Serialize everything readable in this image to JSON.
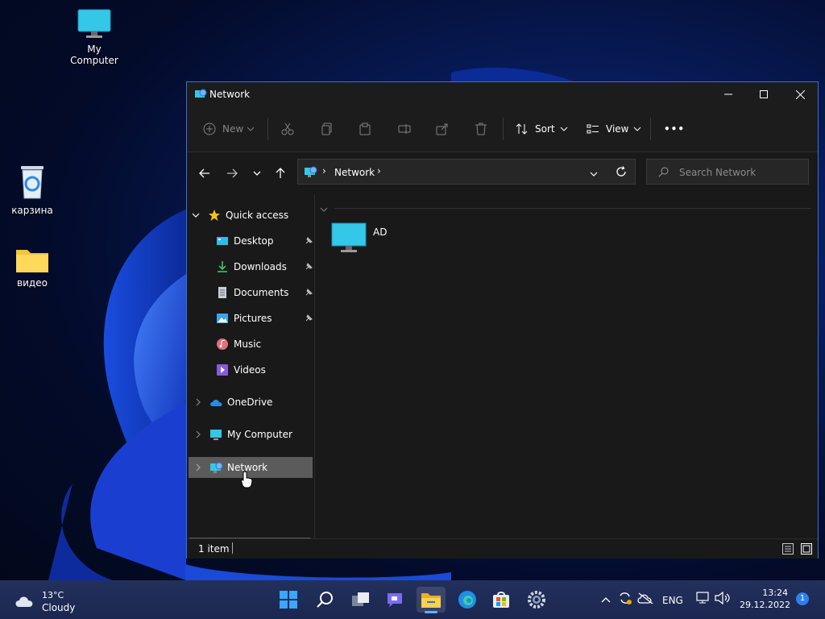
{
  "desktop": {
    "icons": [
      {
        "label": "My Computer",
        "icon": "monitor-icon"
      },
      {
        "label": "карзина",
        "icon": "recycle-bin-icon"
      },
      {
        "label": "видео",
        "icon": "folder-icon"
      }
    ]
  },
  "window": {
    "title": "Network",
    "accent": "#3a6fd8",
    "toolbar": {
      "new_label": "New",
      "sort_label": "Sort",
      "view_label": "View",
      "more_label": "•••"
    },
    "address": {
      "crumb": "Network",
      "separator": "›"
    },
    "search": {
      "placeholder": "Search Network"
    },
    "sidebar": {
      "quick_access": "Quick access",
      "quick_items": [
        {
          "label": "Desktop",
          "icon": "desktop-icon",
          "pinned": true
        },
        {
          "label": "Downloads",
          "icon": "download-icon",
          "pinned": true
        },
        {
          "label": "Documents",
          "icon": "document-icon",
          "pinned": true
        },
        {
          "label": "Pictures",
          "icon": "pictures-icon",
          "pinned": true
        },
        {
          "label": "Music",
          "icon": "music-icon",
          "pinned": false
        },
        {
          "label": "Videos",
          "icon": "videos-icon",
          "pinned": false
        }
      ],
      "onedrive": "OneDrive",
      "my_computer": "My Computer",
      "network": "Network"
    },
    "content": {
      "items": [
        {
          "label": "AD",
          "icon": "computer-icon"
        }
      ]
    },
    "status": {
      "item_count": "1 item"
    }
  },
  "taskbar": {
    "weather_temp": "13°C",
    "weather_desc": "Cloudy",
    "language": "ENG",
    "time": "13:24",
    "date": "29.12.2022",
    "notification_count": "1"
  }
}
